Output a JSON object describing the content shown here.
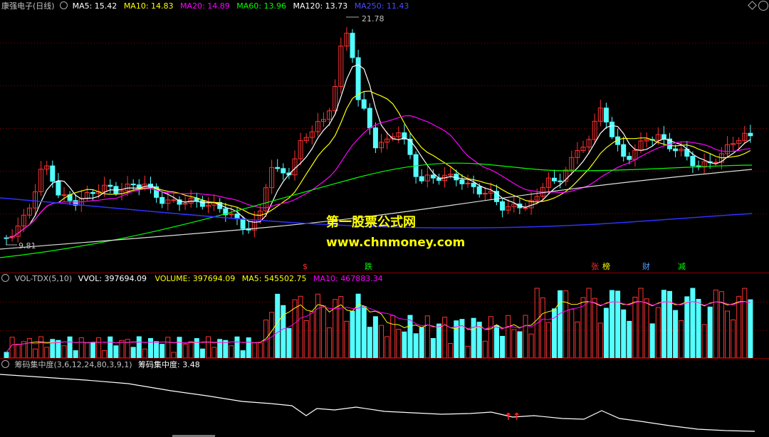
{
  "main_panel": {
    "title": "康强电子(日线)",
    "ma_items": [
      {
        "label": "MA5: 15.42",
        "color": "#ffffff"
      },
      {
        "label": "MA10: 14.83",
        "color": "#ffff00"
      },
      {
        "label": "MA20: 14.89",
        "color": "#ff00ff"
      },
      {
        "label": "MA60: 13.96",
        "color": "#00ff00"
      },
      {
        "label": "MA120: 13.73",
        "color": "#ffffff"
      },
      {
        "label": "MA250: 11.43",
        "color": "#4b4bff"
      }
    ],
    "high_label": "21.78",
    "low_label": "9.81",
    "watermark_title": "第一股票公式网",
    "watermark_url": "www.chnmoney.com",
    "markers": [
      {
        "text": "$",
        "color": "#ff3030"
      },
      {
        "text": "跌",
        "color": "#00ff00"
      },
      {
        "text": "张",
        "color": "#ff3030"
      },
      {
        "text": "榜",
        "color": "#ffff00"
      },
      {
        "text": "财",
        "color": "#4fa3ff"
      },
      {
        "text": "减",
        "color": "#00ff00"
      }
    ]
  },
  "volume_panel": {
    "title": "VOL-TDX(5,10)",
    "items": [
      {
        "label": "VVOL: 397694.09",
        "color": "#ffffff"
      },
      {
        "label": "VOLUME: 397694.09",
        "color": "#ffff00"
      },
      {
        "label": "MA5: 545502.75",
        "color": "#ffff00"
      },
      {
        "label": "MA10: 467883.34",
        "color": "#ff00ff"
      }
    ]
  },
  "indicator_panel": {
    "title": "筹码集中度(3,6,12,24,80,3,9,1)",
    "value_label": "筹码集中度: 3.48",
    "arrows": "↑↑"
  },
  "colors": {
    "up": "#ff3232",
    "down": "#54ffff",
    "grid": "#8b0000"
  }
}
